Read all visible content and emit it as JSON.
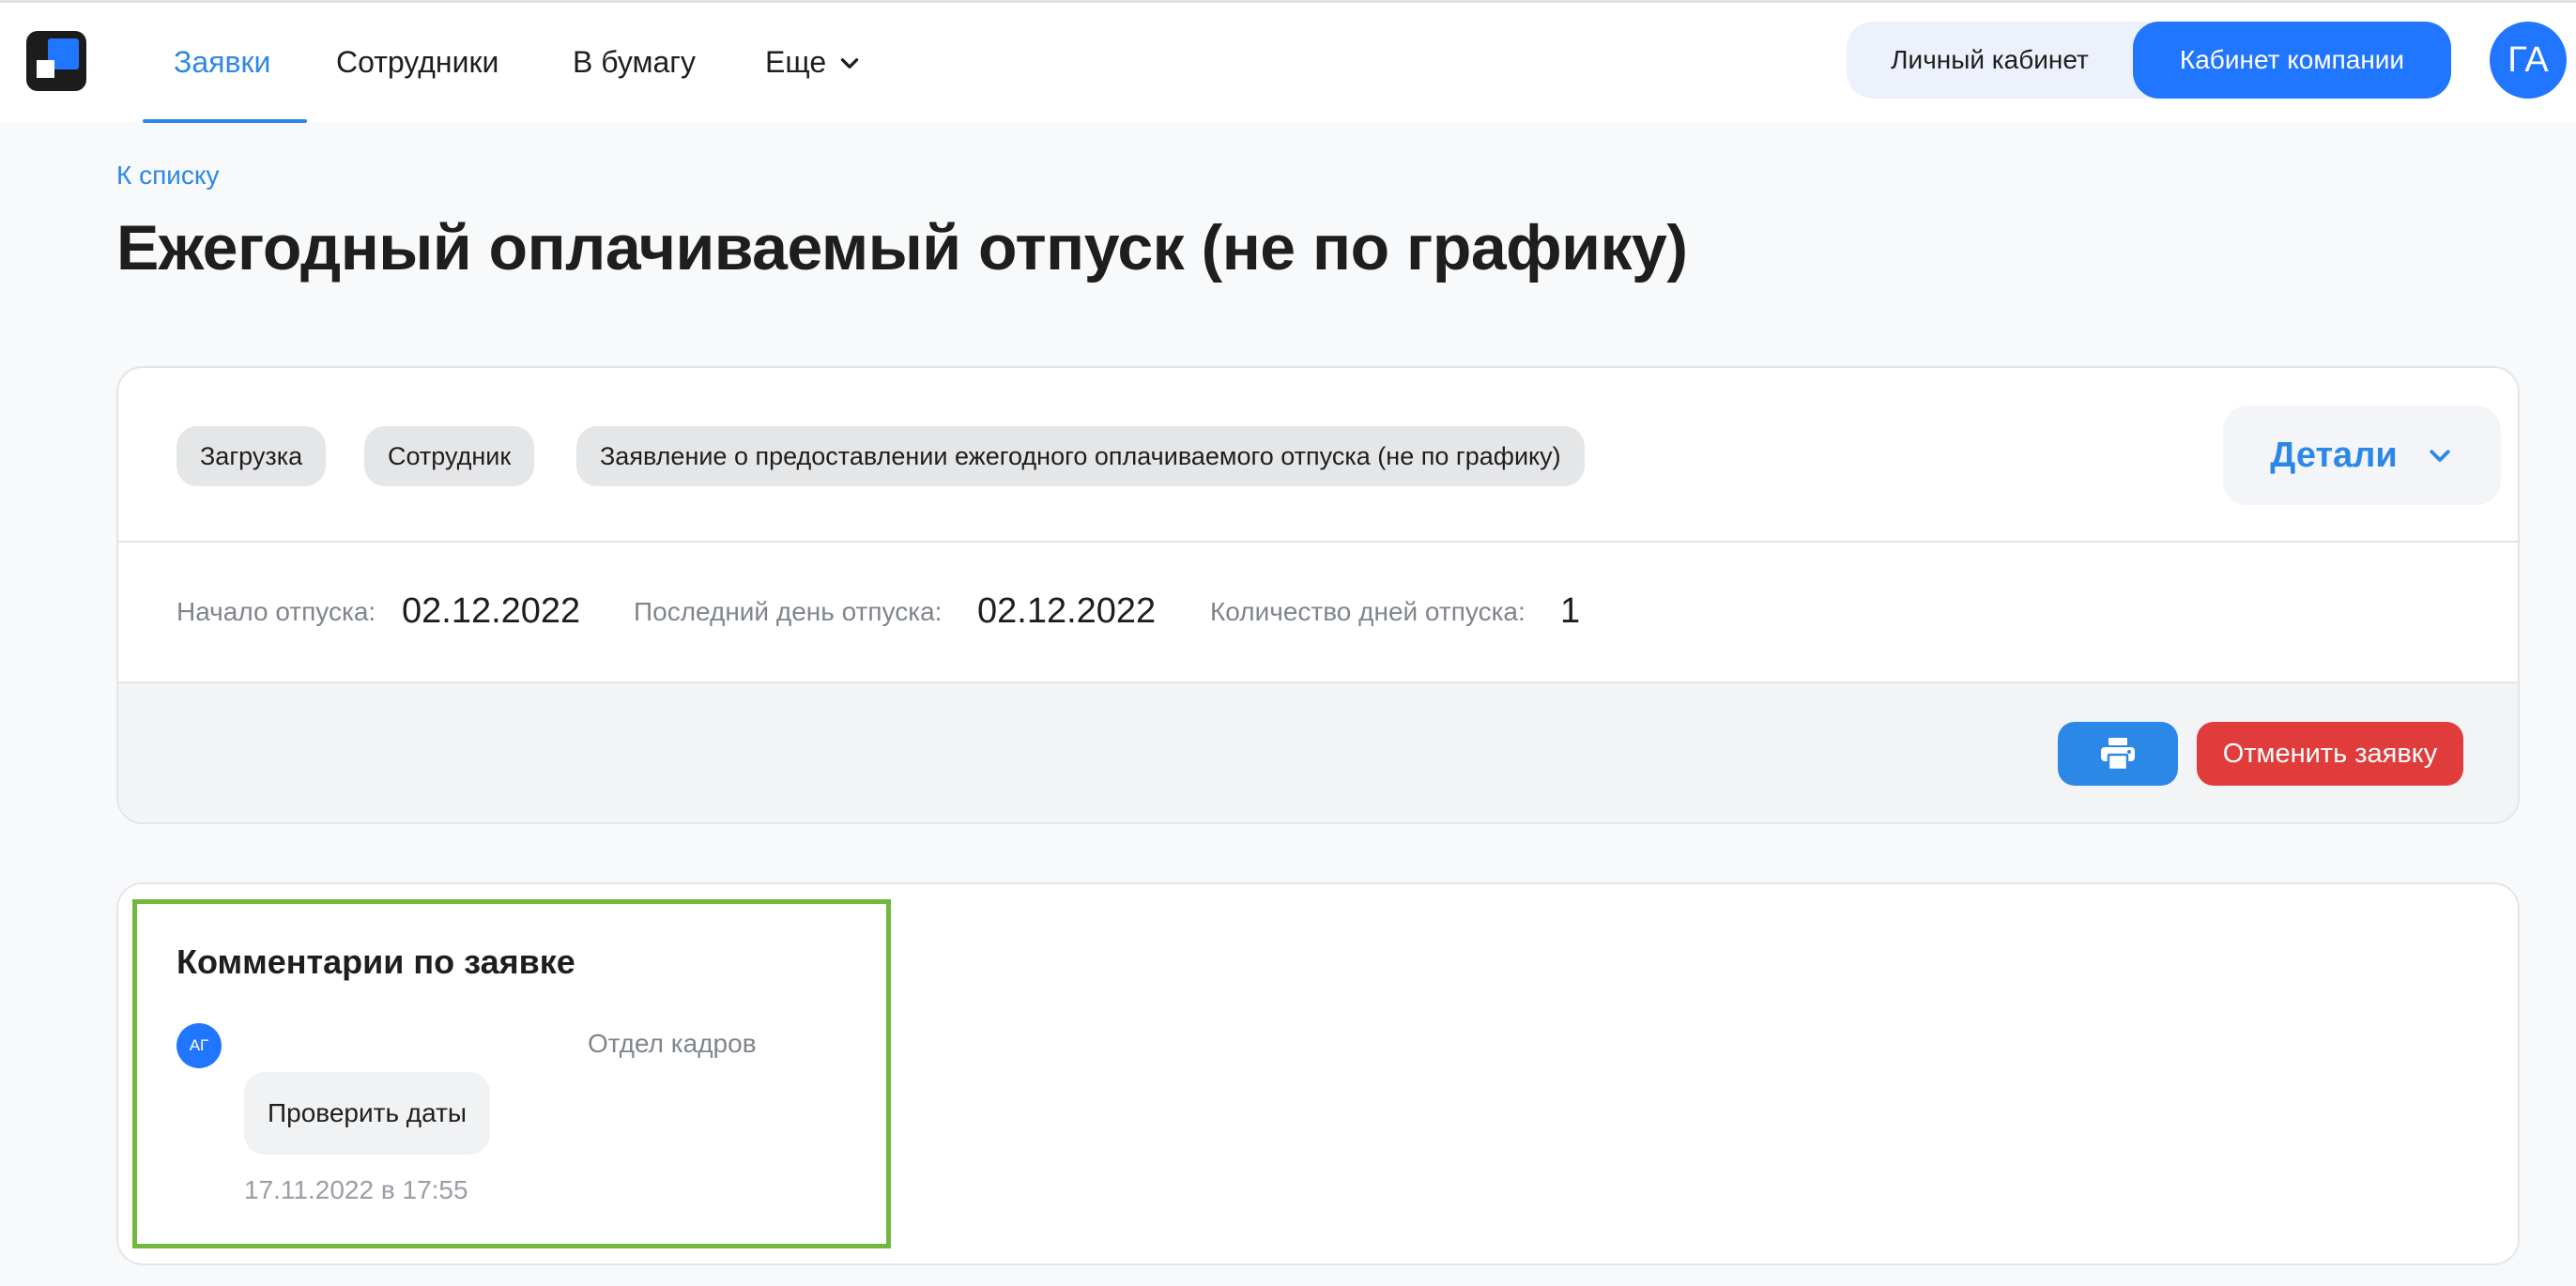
{
  "header": {
    "nav": [
      "Заявки",
      "Сотрудники",
      "В бумагу",
      "Еще"
    ],
    "switch": {
      "personal": "Личный кабинет",
      "company": "Кабинет компании"
    },
    "avatar_initials": "ГА"
  },
  "page": {
    "back_link": "К списку",
    "title": "Ежегодный оплачиваемый отпуск (не по графику)"
  },
  "request": {
    "chips": [
      "Загрузка",
      "Сотрудник",
      "Заявление о предоставлении ежегодного оплачиваемого отпуска (не по графику)"
    ],
    "details_label": "Детали",
    "fields": [
      {
        "label": "Начало отпуска:",
        "value": "02.12.2022"
      },
      {
        "label": "Последний день отпуска:",
        "value": "02.12.2022"
      },
      {
        "label": "Количество дней отпуска:",
        "value": "1"
      }
    ],
    "cancel_label": "Отменить заявку"
  },
  "comments": {
    "title": "Комментарии по заявке",
    "items": [
      {
        "avatar": "АГ",
        "department": "Отдел кадров",
        "text": "Проверить даты",
        "time": "17.11.2022 в 17:55"
      }
    ]
  },
  "colors": {
    "accent": "#2176ff",
    "link": "#2b88e6",
    "danger": "#e03c3c",
    "highlight": "#72b83e"
  }
}
